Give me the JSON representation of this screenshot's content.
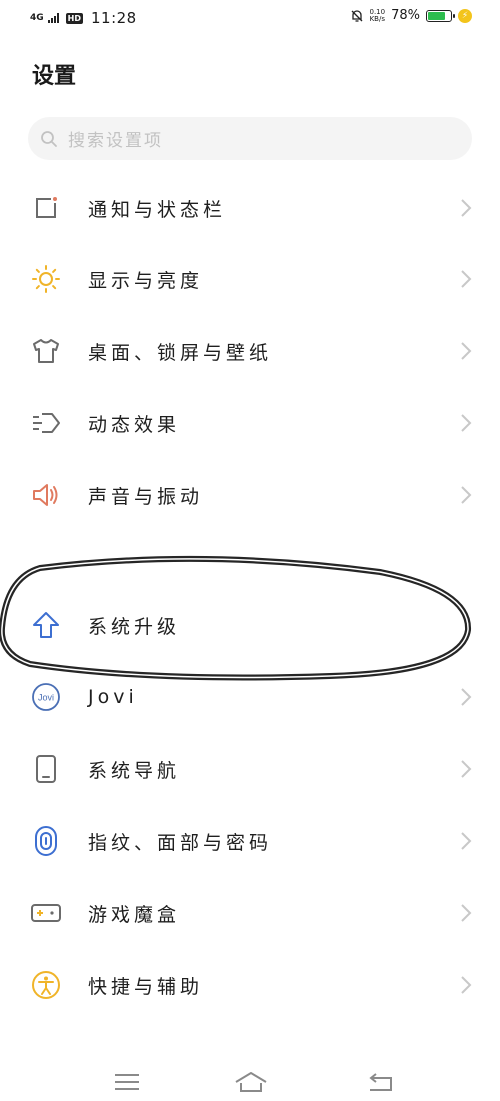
{
  "status_bar": {
    "network": "4G",
    "hd": "HD",
    "time": "11:28",
    "speed_value": "0.10",
    "speed_unit": "KB/s",
    "battery_percent": "78%",
    "battery_level": 0.78
  },
  "header": {
    "title": "设置"
  },
  "search": {
    "placeholder": "搜索设置项"
  },
  "items": [
    {
      "label": "通知与状态栏",
      "icon": "notification-icon"
    },
    {
      "label": "显示与亮度",
      "icon": "brightness-icon"
    },
    {
      "label": "桌面、锁屏与壁纸",
      "icon": "wallpaper-icon"
    },
    {
      "label": "动态效果",
      "icon": "motion-icon"
    },
    {
      "label": "声音与振动",
      "icon": "sound-icon"
    },
    {
      "label": "系统升级",
      "icon": "upgrade-icon"
    },
    {
      "label": "Jovi",
      "icon": "jovi-icon",
      "icon_text": "Jovi"
    },
    {
      "label": "系统导航",
      "icon": "navigation-icon"
    },
    {
      "label": "指纹、面部与密码",
      "icon": "fingerprint-icon"
    },
    {
      "label": "游戏魔盒",
      "icon": "game-box-icon"
    },
    {
      "label": "快捷与辅助",
      "icon": "accessibility-icon"
    }
  ],
  "colors": {
    "brightness": "#f0b429",
    "sound": "#e07a5f",
    "upgrade": "#3d6fd1",
    "jovi": "#4a6fb5",
    "fingerprint": "#3d6fd1",
    "accessibility": "#f0b429",
    "icon_gray": "#6b6b6b",
    "battery": "#2dbd4e"
  }
}
